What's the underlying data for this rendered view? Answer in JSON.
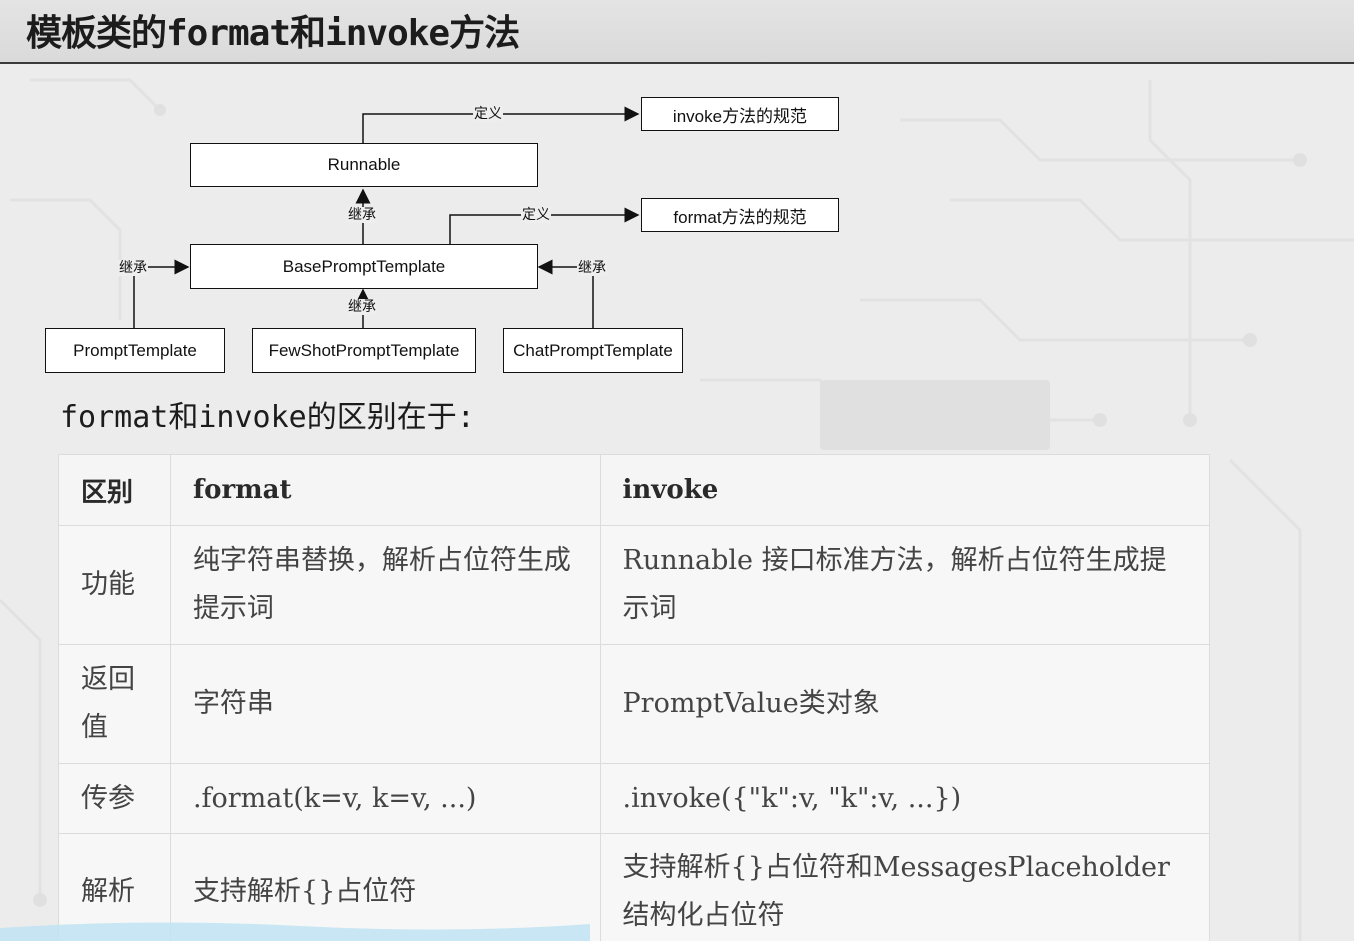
{
  "title": "模板类的format和invoke方法",
  "diagram": {
    "nodes": {
      "runnable": "Runnable",
      "invoke_spec": "invoke方法的规范",
      "format_spec": "format方法的规范",
      "base": "BasePromptTemplate",
      "prompt": "PromptTemplate",
      "fewshot": "FewShotPromptTemplate",
      "chat": "ChatPromptTemplate"
    },
    "edges": {
      "define_invoke": "定义",
      "define_format": "定义",
      "inherit_runnable": "继承",
      "inherit_left": "继承",
      "inherit_right": "继承",
      "inherit_fewshot": "继承"
    }
  },
  "subtitle": "format和invoke的区别在于:",
  "table": {
    "headers": [
      "区别",
      "format",
      "invoke"
    ],
    "rows": [
      [
        "功能",
        "纯字符串替换，解析占位符生成提示词",
        "Runnable 接口标准方法，解析占位符生成提示词"
      ],
      [
        "返回值",
        "字符串",
        "PromptValue类对象"
      ],
      [
        "传参",
        ".format(k=v, k=v, ...)",
        ".invoke({\"k\":v, \"k\":v, ...})"
      ],
      [
        "解析",
        "支持解析{}占位符",
        "支持解析{}占位符和MessagesPlaceholder结构化占位符"
      ]
    ]
  }
}
